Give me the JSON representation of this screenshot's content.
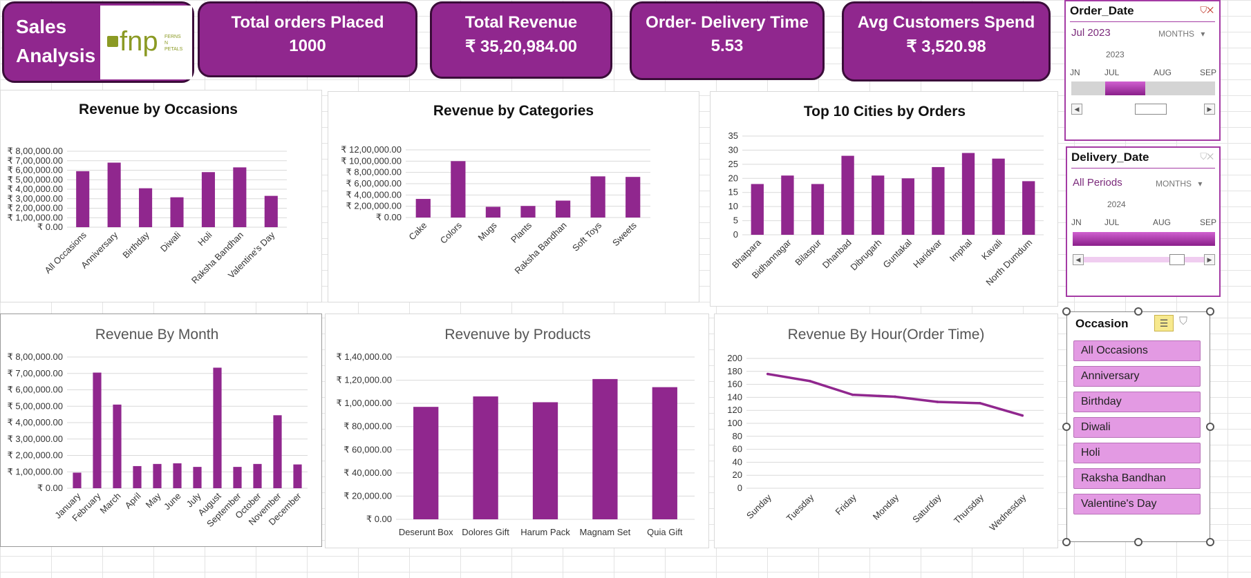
{
  "header": {
    "title_line1": "Sales",
    "title_line2": "Analysis",
    "logo_text": "fnp",
    "logo_sub1": "FERNS",
    "logo_sub2": "N",
    "logo_sub3": "PETALS"
  },
  "kpis": [
    {
      "title": "Total orders Placed",
      "value": "1000"
    },
    {
      "title": "Total Revenue",
      "value": "₹ 35,20,984.00"
    },
    {
      "title": "Order- Delivery Time",
      "value": "5.53"
    },
    {
      "title": "Avg Customers Spend",
      "value": "₹ 3,520.98"
    }
  ],
  "colors": {
    "accent": "#90278e",
    "bar": "#90278e",
    "slicer_item": "#e39ae3"
  },
  "chart_data": [
    {
      "id": "occasions",
      "type": "bar",
      "title": "Revenue by Occasions",
      "categories": [
        "All Occasions",
        "Anniversary",
        "Birthday",
        "Diwali",
        "Holi",
        "Raksha Bandhan",
        "Valentine's Day"
      ],
      "values": [
        590000,
        680000,
        410000,
        315000,
        580000,
        630000,
        330000
      ],
      "ylim": [
        0,
        800000
      ],
      "ticks": [
        "₹ 0.00",
        "₹ 1,00,000.00",
        "₹ 2,00,000.00",
        "₹ 3,00,000.00",
        "₹ 4,00,000.00",
        "₹ 5,00,000.00",
        "₹ 6,00,000.00",
        "₹ 7,00,000.00",
        "₹ 8,00,000.00"
      ]
    },
    {
      "id": "categories",
      "type": "bar",
      "title": "Revenue by Categories",
      "categories": [
        "Cake",
        "Colors",
        "Mugs",
        "Plants",
        "Raksha Bandhan",
        "Soft Toys",
        "Sweets"
      ],
      "values": [
        330000,
        1000000,
        190000,
        205000,
        300000,
        730000,
        720000
      ],
      "ylim": [
        0,
        1200000
      ],
      "ticks": [
        "₹ 0.00",
        "₹ 2,00,000.00",
        "₹ 4,00,000.00",
        "₹ 6,00,000.00",
        "₹ 8,00,000.00",
        "₹ 10,00,000.00",
        "₹ 12,00,000.00"
      ]
    },
    {
      "id": "cities",
      "type": "bar",
      "title": "Top  10 Cities by Orders",
      "categories": [
        "Bhatpara",
        "Bidhannagar",
        "Bilaspur",
        "Dhanbad",
        "Dibrugarh",
        "Guntakal",
        "Haridwar",
        "Imphal",
        "Kavali",
        "North Dumdum"
      ],
      "values": [
        18,
        21,
        18,
        28,
        21,
        20,
        24,
        29,
        27,
        19
      ],
      "ylim": [
        0,
        35
      ],
      "ticks": [
        "0",
        "5",
        "10",
        "15",
        "20",
        "25",
        "30",
        "35"
      ]
    },
    {
      "id": "month",
      "type": "bar",
      "title": "Revenue By Month",
      "categories": [
        "January",
        "February",
        "March",
        "April",
        "May",
        "June",
        "July",
        "August",
        "September",
        "October",
        "November",
        "December"
      ],
      "values": [
        95000,
        705000,
        510000,
        135000,
        148000,
        152000,
        130000,
        735000,
        130000,
        148000,
        445000,
        145000
      ],
      "ylim": [
        0,
        800000
      ],
      "ticks": [
        "₹ 0.00",
        "₹ 1,00,000.00",
        "₹ 2,00,000.00",
        "₹ 3,00,000.00",
        "₹ 4,00,000.00",
        "₹ 5,00,000.00",
        "₹ 6,00,000.00",
        "₹ 7,00,000.00",
        "₹ 8,00,000.00"
      ]
    },
    {
      "id": "products",
      "type": "bar",
      "title": "Revenuve by  Products",
      "categories": [
        "Deserunt Box",
        "Dolores Gift",
        "Harum Pack",
        "Magnam Set",
        "Quia Gift"
      ],
      "values": [
        97000,
        106000,
        101000,
        121000,
        114000
      ],
      "ylim": [
        0,
        140000
      ],
      "ticks": [
        "₹ 0.00",
        "₹ 20,000.00",
        "₹ 40,000.00",
        "₹ 60,000.00",
        "₹ 80,000.00",
        "₹ 1,00,000.00",
        "₹ 1,20,000.00",
        "₹ 1,40,000.00"
      ]
    },
    {
      "id": "hour",
      "type": "line",
      "title": "Revenue By Hour(Order Time)",
      "categories": [
        "Sunday",
        "Tuesday",
        "Friday",
        "Monday",
        "Saturday",
        "Thursday",
        "Wednesday"
      ],
      "values": [
        176,
        165,
        144,
        141,
        133,
        131,
        112
      ],
      "ylim": [
        0,
        200
      ],
      "ticks": [
        "0",
        "20",
        "40",
        "60",
        "80",
        "100",
        "120",
        "140",
        "160",
        "180",
        "200"
      ]
    }
  ],
  "slicers": {
    "order_date": {
      "title": "Order_Date",
      "selected": "Jul 2023",
      "level": "MONTHS",
      "year": "2023",
      "months": [
        "JN",
        "JUL",
        "AUG",
        "SEP"
      ],
      "selected_fraction": 0.28
    },
    "delivery_date": {
      "title": "Delivery_Date",
      "selected": "All Periods",
      "level": "MONTHS",
      "year": "2024",
      "months": [
        "JN",
        "JUL",
        "AUG",
        "SEP"
      ],
      "selected_fraction": 1.0
    },
    "occasion": {
      "title": "Occasion",
      "items": [
        "All Occasions",
        "Anniversary",
        "Birthday",
        "Diwali",
        "Holi",
        "Raksha Bandhan",
        "Valentine's Day"
      ]
    }
  }
}
